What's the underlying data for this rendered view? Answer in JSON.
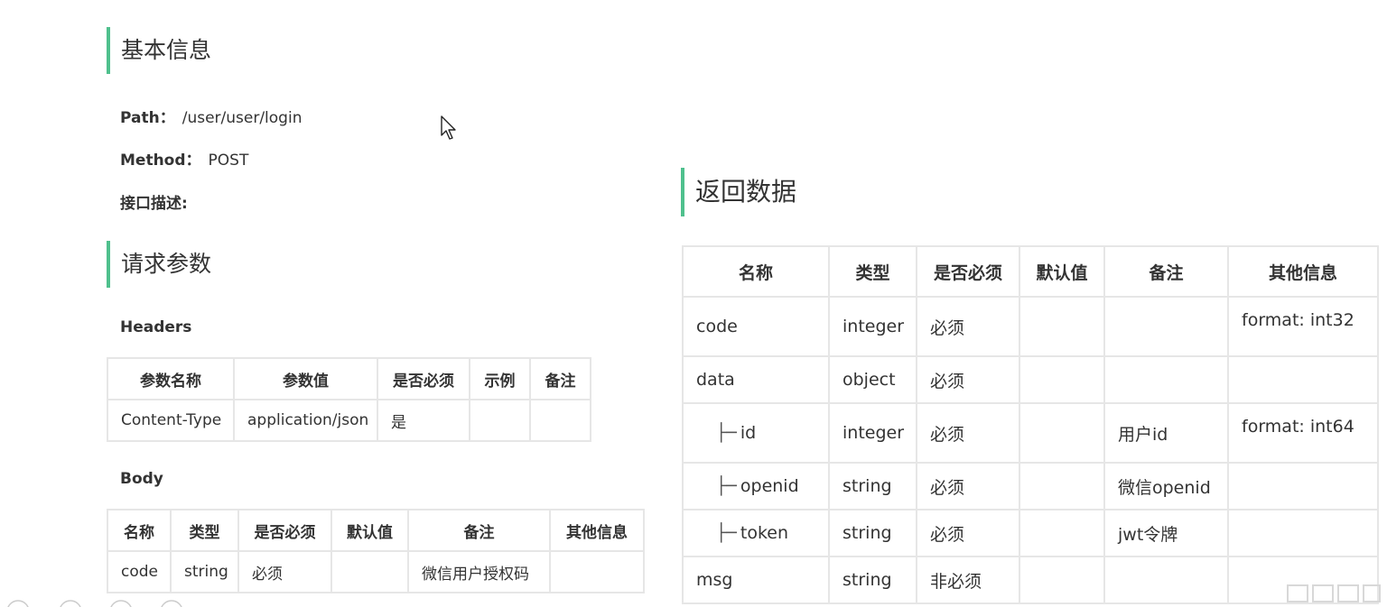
{
  "basic_info": {
    "title": "基本信息",
    "path_label": "Path：",
    "path_value": "/user/user/login",
    "method_label": "Method：",
    "method_value": "POST",
    "desc_label": "接口描述:"
  },
  "request": {
    "title": "请求参数",
    "headers_title": "Headers",
    "headers_table": {
      "columns": [
        "参数名称",
        "参数值",
        "是否必须",
        "示例",
        "备注"
      ],
      "rows": [
        [
          "Content-Type",
          "application/json",
          "是",
          "",
          ""
        ]
      ]
    },
    "body_title": "Body",
    "body_table": {
      "columns": [
        "名称",
        "类型",
        "是否必须",
        "默认值",
        "备注",
        "其他信息"
      ],
      "rows": [
        [
          "code",
          "string",
          "必须",
          "",
          "微信用户授权码",
          ""
        ]
      ]
    }
  },
  "response": {
    "title": "返回数据",
    "tree_prefix": "├─",
    "table": {
      "columns": [
        "名称",
        "类型",
        "是否必须",
        "默认值",
        "备注",
        "其他信息"
      ],
      "rows": [
        [
          "code",
          "integer",
          "必须",
          "",
          "",
          "format: int32"
        ],
        [
          "data",
          "object",
          "必须",
          "",
          "",
          ""
        ],
        [
          "id",
          "integer",
          "必须",
          "",
          "用户id",
          "format: int64"
        ],
        [
          "openid",
          "string",
          "必须",
          "",
          "微信openid",
          ""
        ],
        [
          "token",
          "string",
          "必须",
          "",
          "jwt令牌",
          ""
        ],
        [
          "msg",
          "string",
          "非必须",
          "",
          "",
          ""
        ]
      ]
    }
  },
  "colors": {
    "accent": "#4fc08d",
    "border": "#e6e6e6",
    "text": "#333333"
  }
}
